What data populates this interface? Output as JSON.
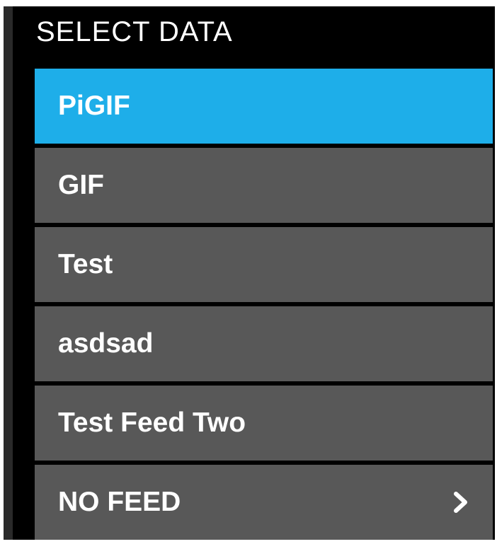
{
  "header": {
    "title": "SELECT DATA"
  },
  "feeds": {
    "selected_index": 0,
    "items": [
      {
        "label": "PiGIF"
      },
      {
        "label": "GIF"
      },
      {
        "label": "Test"
      },
      {
        "label": "asdsad"
      },
      {
        "label": "Test Feed Two"
      },
      {
        "label": "NO FEED",
        "icon": "chevron-right-icon"
      }
    ]
  },
  "colors": {
    "background": "#000000",
    "item": "#585858",
    "selected": "#1eaee9",
    "text": "#ffffff"
  }
}
